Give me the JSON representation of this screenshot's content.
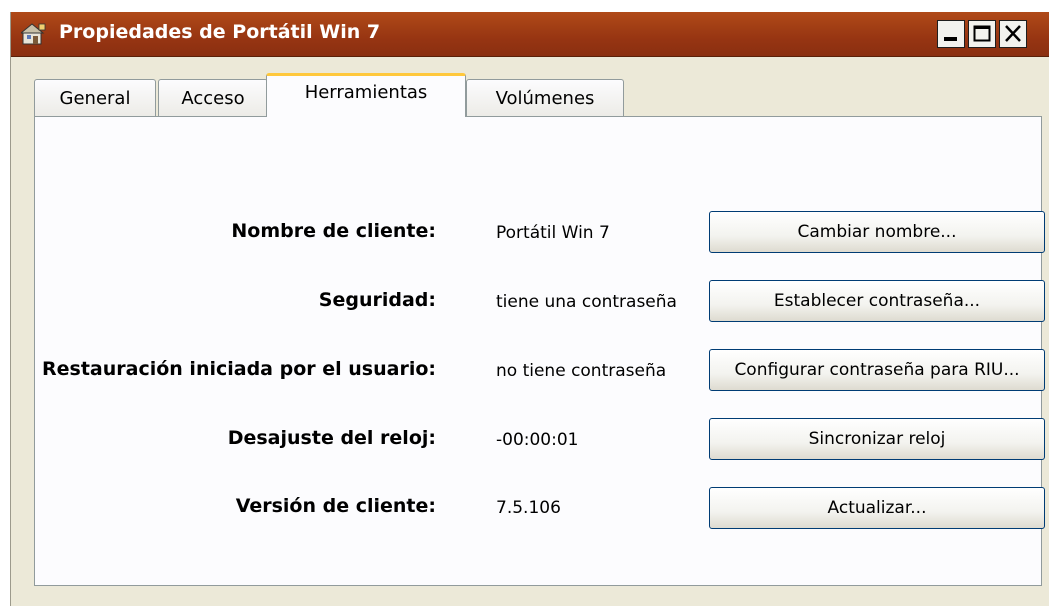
{
  "window": {
    "title": "Propiedades de Portátil Win 7",
    "icon": "properties-icon",
    "controls": [
      "minimize-icon",
      "maximize-icon",
      "close-icon"
    ]
  },
  "tabs": [
    {
      "label": "General",
      "active": false
    },
    {
      "label": "Acceso",
      "active": false
    },
    {
      "label": "Herramientas",
      "active": true
    },
    {
      "label": "Volúmenes",
      "active": false
    }
  ],
  "rows": [
    {
      "label": "Nombre de cliente:",
      "value": "Portátil Win 7",
      "button": "Cambiar nombre..."
    },
    {
      "label": "Seguridad:",
      "value": "tiene una contraseña",
      "button": "Establecer contraseña..."
    },
    {
      "label": "Restauración iniciada por el usuario:",
      "value": "no tiene contraseña",
      "button": "Configurar contraseña para RIU..."
    },
    {
      "label": "Desajuste del reloj:",
      "value": "-00:00:01",
      "button": "Sincronizar reloj"
    },
    {
      "label": "Versión de cliente:",
      "value": "7.5.106",
      "button": "Actualizar..."
    }
  ],
  "colors": {
    "titlebar": "#973512",
    "tab_highlight": "#ffc83c",
    "panel": "#fcfcfe",
    "window": "#ece9d8"
  }
}
